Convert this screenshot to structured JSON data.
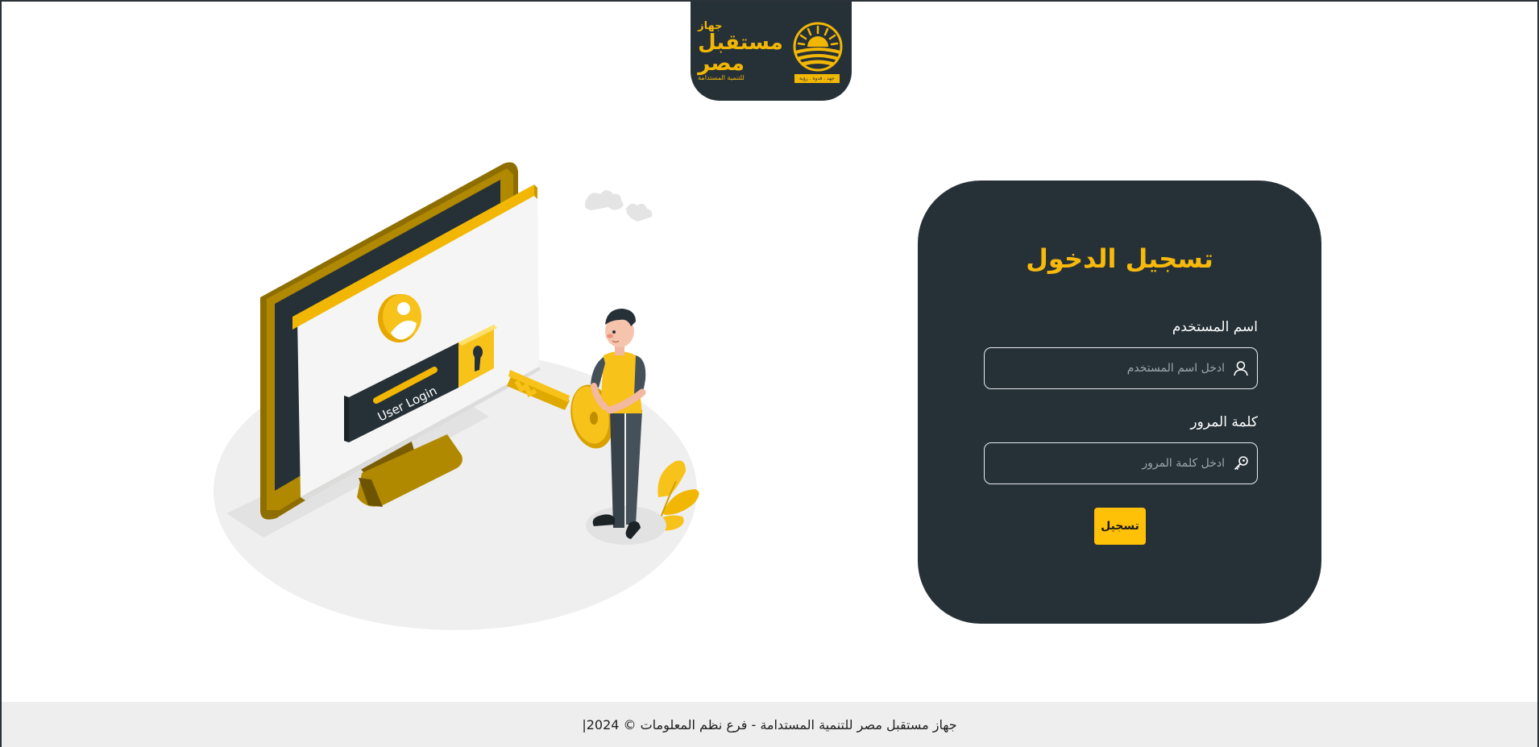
{
  "logo": {
    "line1": "جهاز",
    "line2": "مستقبل",
    "line3": "مصر",
    "line4": "للتنمية المستدامة",
    "tagline": "جهد . قدوة . رؤية",
    "icon": "sun-over-fields-icon"
  },
  "illustration": {
    "button_text": "User Login",
    "icon": "user-login-key-illustration"
  },
  "login": {
    "title": "تسجيل الدخول",
    "username": {
      "label": "اسم المستخدم",
      "placeholder": "ادخل اسم المستخدم",
      "icon": "user-icon"
    },
    "password": {
      "label": "كلمة المرور",
      "placeholder": "ادخل كلمة المرور",
      "icon": "key-icon"
    },
    "submit_label": "تسجيل"
  },
  "footer": {
    "text": "جهاز مستقبل مصر للتنمية المستدامة - فرع نظم المعلومات © 2024|"
  },
  "colors": {
    "dark": "#263137",
    "accent": "#ffc107",
    "title": "#f7b90b"
  }
}
